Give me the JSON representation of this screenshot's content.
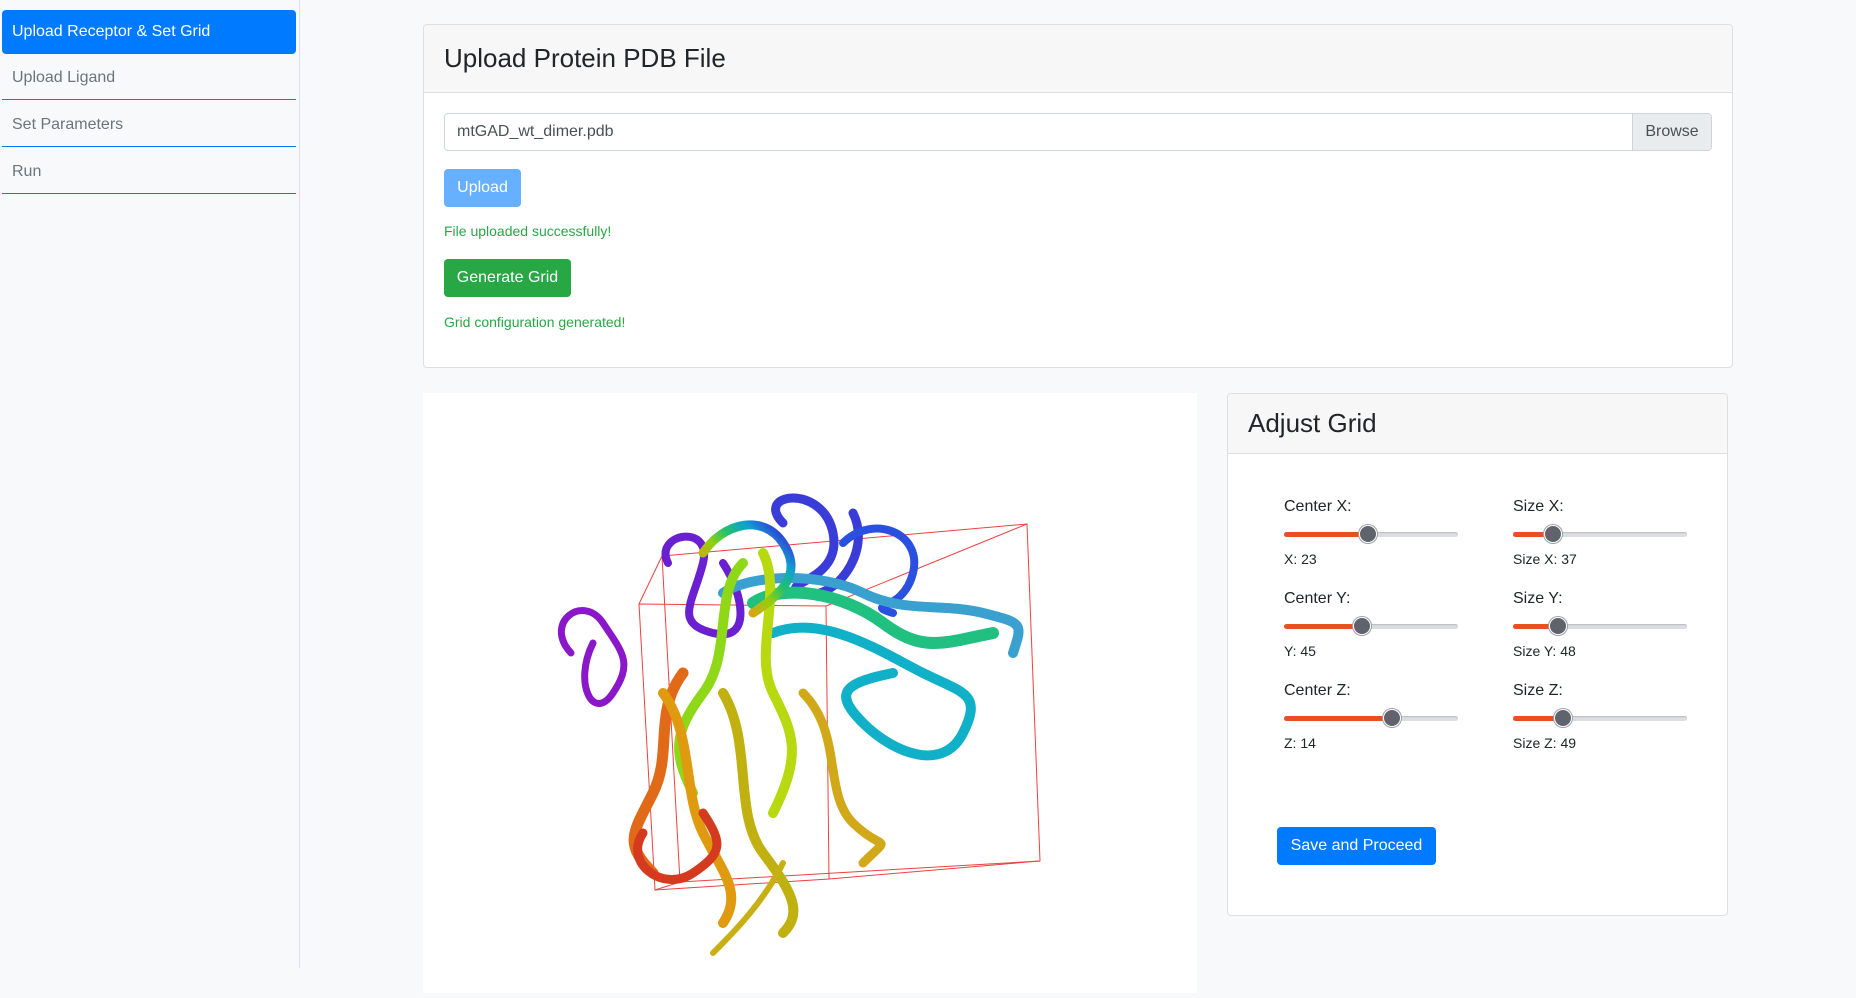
{
  "sidebar": {
    "items": [
      {
        "label": "Upload Receptor & Set Grid",
        "active": true
      },
      {
        "label": "Upload Ligand",
        "active": false
      },
      {
        "label": "Set Parameters",
        "active": false
      },
      {
        "label": "Run",
        "active": false
      }
    ]
  },
  "upload": {
    "title": "Upload Protein PDB File",
    "file_name": "mtGAD_wt_dimer.pdb",
    "browse_label": "Browse",
    "upload_label": "Upload",
    "upload_status": "File uploaded successfully!",
    "generate_label": "Generate Grid",
    "grid_status": "Grid configuration generated!"
  },
  "adjust": {
    "title": "Adjust Grid",
    "center_x": {
      "label": "Center X:",
      "value_text": "X: 23",
      "fraction": 0.48
    },
    "center_y": {
      "label": "Center Y:",
      "value_text": "Y: 45",
      "fraction": 0.45
    },
    "center_z": {
      "label": "Center Z:",
      "value_text": "Z: 14",
      "fraction": 0.62
    },
    "size_x": {
      "label": "Size X:",
      "value_text": "Size X: 37",
      "fraction": 0.23
    },
    "size_y": {
      "label": "Size Y:",
      "value_text": "Size Y: 48",
      "fraction": 0.26
    },
    "size_z": {
      "label": "Size Z:",
      "value_text": "Size Z: 49",
      "fraction": 0.29
    },
    "save_label": "Save and Proceed"
  },
  "colors": {
    "primary": "#007bff",
    "success": "#28a745",
    "slider_fill": "#e8501f"
  }
}
